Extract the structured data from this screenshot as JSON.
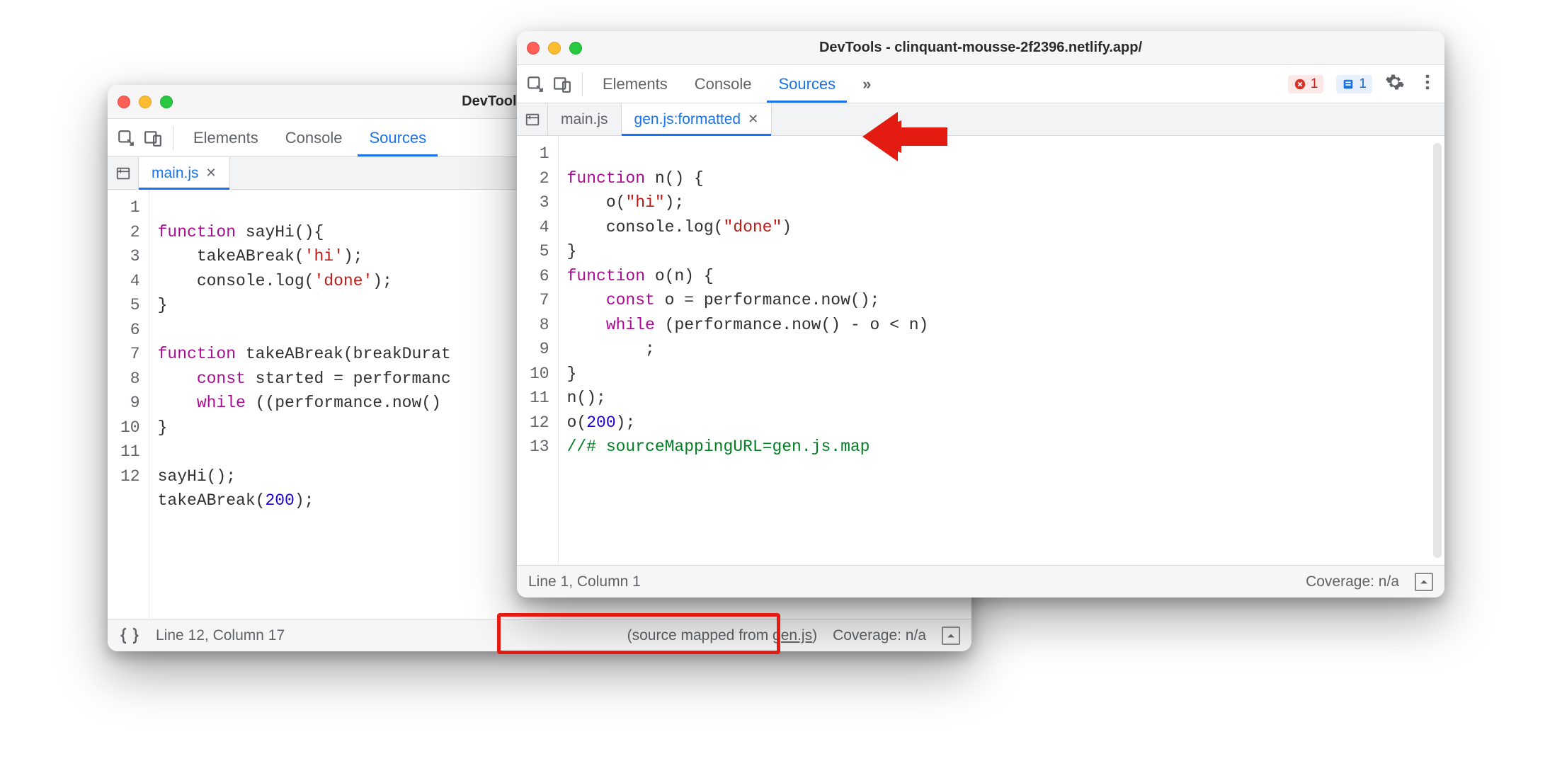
{
  "windowA": {
    "title": "DevTools - clinquant-m",
    "devtabs": [
      "Elements",
      "Console",
      "Sources"
    ],
    "devtab_active_index": 2,
    "filetabs": [
      {
        "label": "main.js",
        "closeable": true
      }
    ],
    "filetab_active_index": 0,
    "gutter": [
      "1",
      "2",
      "3",
      "4",
      "5",
      "6",
      "7",
      "8",
      "9",
      "10",
      "11",
      "12"
    ],
    "code_lines": [
      {
        "pre": "",
        "kw": "function",
        "rest": " sayHi(){"
      },
      {
        "pre": "    ",
        "kw": "",
        "callA": "takeABreak(",
        "strA": "'hi'",
        "after": ");"
      },
      {
        "pre": "    ",
        "kw": "",
        "callA": "console.log(",
        "strA": "'done'",
        "after": ");"
      },
      {
        "pre": "",
        "kw": "",
        "rest": "}"
      },
      {
        "pre": "",
        "kw": "",
        "rest": " "
      },
      {
        "pre": "",
        "kw": "function",
        "rest": " takeABreak(breakDurat"
      },
      {
        "pre": "    ",
        "kw": "const",
        "rest": " started = performanc"
      },
      {
        "pre": "    ",
        "kw": "while",
        "rest": " ((performance.now() "
      },
      {
        "pre": "",
        "kw": "",
        "rest": "}"
      },
      {
        "pre": "",
        "kw": "",
        "rest": " "
      },
      {
        "pre": "",
        "kw": "",
        "callA": "sayHi();",
        "strA": "",
        "after": ""
      },
      {
        "pre": "",
        "kw": "",
        "callA": "takeABreak(",
        "numA": "200",
        "after": ");"
      }
    ],
    "status": {
      "braces": "{ }",
      "pos": "Line 12, Column 17",
      "mapped_prefix": "(source mapped from ",
      "mapped_link": "gen.js",
      "mapped_suffix": ")",
      "coverage": "Coverage: n/a"
    }
  },
  "windowB": {
    "title": "DevTools - clinquant-mousse-2f2396.netlify.app/",
    "devtabs": [
      "Elements",
      "Console",
      "Sources"
    ],
    "devtab_active_index": 2,
    "more_glyph": "»",
    "badges": {
      "errors": "1",
      "infos": "1"
    },
    "filetabs": [
      {
        "label": "main.js",
        "closeable": false
      },
      {
        "label": "gen.js:formatted",
        "closeable": true
      }
    ],
    "filetab_active_index": 1,
    "gutter": [
      "1",
      "2",
      "3",
      "4",
      "5",
      "6",
      "7",
      "8",
      "9",
      "10",
      "11",
      "12",
      "13"
    ],
    "code_lines": [
      {
        "kw": "function",
        "rest": " n() {"
      },
      {
        "pre": "    ",
        "callA": "o(",
        "strA": "\"hi\"",
        "after": ");"
      },
      {
        "pre": "    ",
        "callA": "console.log(",
        "strA": "\"done\"",
        "after": ")"
      },
      {
        "rest": "}"
      },
      {
        "kw": "function",
        "rest": " o(n) {"
      },
      {
        "pre": "    ",
        "kw": "const",
        "rest": " o = performance.now();"
      },
      {
        "pre": "    ",
        "kw": "while",
        "rest": " (performance.now() - o < n)"
      },
      {
        "pre": "        ",
        "rest": ";"
      },
      {
        "rest": "}"
      },
      {
        "rest": "n();"
      },
      {
        "callA": "o(",
        "numA": "200",
        "after": ");"
      },
      {
        "cm": "//# sourceMappingURL=gen.js.map"
      },
      {
        "rest": " "
      }
    ],
    "status": {
      "pos": "Line 1, Column 1",
      "coverage": "Coverage: n/a"
    }
  }
}
